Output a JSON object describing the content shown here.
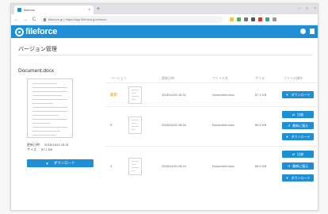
{
  "browser": {
    "tab_title": "fileforce",
    "tab_close": "×",
    "new_tab": "+",
    "win_min": "–",
    "win_max": "□",
    "win_close": "×",
    "url": "fileforce.jp | https://app.fileforce.jp/version",
    "back": "←",
    "forward": "→",
    "reload": "C"
  },
  "app": {
    "logo_text": "fileforce",
    "brand_color": "#1e8fd5"
  },
  "page": {
    "title": "バージョン管理",
    "doc_name": "Document.docx",
    "meta_label_1": "更新日時",
    "meta_value_1": "2018/11/20  15:31",
    "meta_label_2": "サイズ",
    "meta_value_2": "87.1 KB",
    "download_label": "ダウンロード",
    "download_icon": "▼"
  },
  "table": {
    "headers": [
      "バージョン",
      "更新日時",
      "ファイル名",
      "サイズ",
      "ファイル操作"
    ],
    "rows": [
      {
        "version": "最新",
        "date": "2018/11/20  15:31",
        "filename": "Document.docx",
        "size": "87.1 KB",
        "actions": [
          "ダウンロード"
        ]
      },
      {
        "version": "2",
        "date": "2018/11/20  15:30",
        "filename": "Document.docx",
        "size": "86.9 KB",
        "actions": [
          "比較",
          "最新に復元",
          "ダウンロード"
        ]
      },
      {
        "version": "1",
        "date": "2018/11/20  15:24",
        "filename": "Document.docx",
        "size": "86.0 KB",
        "actions": [
          "比較",
          "最新に復元",
          "ダウンロード"
        ]
      }
    ]
  }
}
